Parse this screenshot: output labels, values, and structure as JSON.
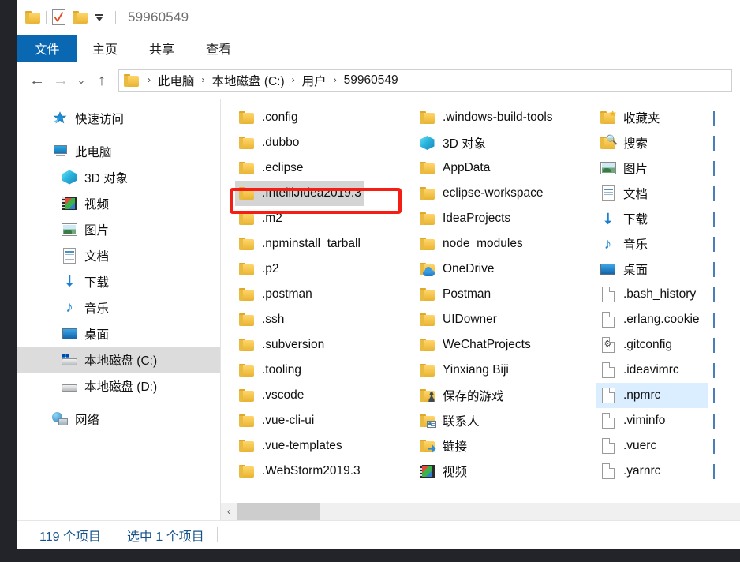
{
  "window": {
    "title": "59960549",
    "quick_access": [
      "folder-icon",
      "checkbox-doc-icon",
      "folder-icon",
      "dropdown-arrow"
    ]
  },
  "ribbon": {
    "tabs": [
      {
        "label": "文件",
        "active": true
      },
      {
        "label": "主页",
        "active": false
      },
      {
        "label": "共享",
        "active": false
      },
      {
        "label": "查看",
        "active": false
      }
    ]
  },
  "addressbar": {
    "back": "←",
    "forward": "→",
    "recent": "⌄",
    "up": "↑",
    "separator": "›",
    "crumbs": [
      "此电脑",
      "本地磁盘 (C:)",
      "用户",
      "59960549"
    ]
  },
  "navpane": {
    "items": [
      {
        "label": "快速访问",
        "icon": "pin-star-icon",
        "level": 1,
        "selected": false,
        "gap_after": true
      },
      {
        "label": "此电脑",
        "icon": "this-pc-icon",
        "level": 1,
        "selected": false
      },
      {
        "label": "3D 对象",
        "icon": "3d-objects-icon",
        "level": 2,
        "selected": false
      },
      {
        "label": "视频",
        "icon": "videos-icon",
        "level": 2,
        "selected": false
      },
      {
        "label": "图片",
        "icon": "pictures-icon",
        "level": 2,
        "selected": false
      },
      {
        "label": "文档",
        "icon": "documents-icon",
        "level": 2,
        "selected": false
      },
      {
        "label": "下载",
        "icon": "downloads-icon",
        "level": 2,
        "selected": false
      },
      {
        "label": "音乐",
        "icon": "music-icon",
        "level": 2,
        "selected": false
      },
      {
        "label": "桌面",
        "icon": "desktop-icon",
        "level": 2,
        "selected": false
      },
      {
        "label": "本地磁盘 (C:)",
        "icon": "windows-drive-icon",
        "level": 2,
        "selected": true
      },
      {
        "label": "本地磁盘 (D:)",
        "icon": "drive-icon",
        "level": 2,
        "selected": false,
        "gap_after": true
      },
      {
        "label": "网络",
        "icon": "network-icon",
        "level": 1,
        "selected": false
      }
    ]
  },
  "filelist": {
    "columns": [
      {
        "items": [
          {
            "name": ".config",
            "icon": "folder-icon",
            "state": "normal"
          },
          {
            "name": ".dubbo",
            "icon": "folder-icon",
            "state": "normal"
          },
          {
            "name": ".eclipse",
            "icon": "folder-icon",
            "state": "normal"
          },
          {
            "name": ".IntelliJIdea2019.3",
            "icon": "folder-icon",
            "state": "selected"
          },
          {
            "name": ".m2",
            "icon": "folder-icon",
            "state": "normal"
          },
          {
            "name": ".npminstall_tarball",
            "icon": "folder-icon",
            "state": "normal"
          },
          {
            "name": ".p2",
            "icon": "folder-icon",
            "state": "normal"
          },
          {
            "name": ".postman",
            "icon": "folder-icon",
            "state": "normal"
          },
          {
            "name": ".ssh",
            "icon": "folder-icon",
            "state": "normal"
          },
          {
            "name": ".subversion",
            "icon": "folder-icon",
            "state": "normal"
          },
          {
            "name": ".tooling",
            "icon": "folder-icon",
            "state": "normal"
          },
          {
            "name": ".vscode",
            "icon": "folder-icon",
            "state": "normal"
          },
          {
            "name": ".vue-cli-ui",
            "icon": "folder-icon",
            "state": "normal"
          },
          {
            "name": ".vue-templates",
            "icon": "folder-icon",
            "state": "normal"
          },
          {
            "name": ".WebStorm2019.3",
            "icon": "folder-icon",
            "state": "normal"
          }
        ]
      },
      {
        "items": [
          {
            "name": ".windows-build-tools",
            "icon": "folder-icon",
            "state": "normal"
          },
          {
            "name": "3D 对象",
            "icon": "3d-objects-icon",
            "state": "normal"
          },
          {
            "name": "AppData",
            "icon": "folder-icon",
            "state": "normal"
          },
          {
            "name": "eclipse-workspace",
            "icon": "folder-icon",
            "state": "normal"
          },
          {
            "name": "IdeaProjects",
            "icon": "folder-icon",
            "state": "normal"
          },
          {
            "name": "node_modules",
            "icon": "folder-icon",
            "state": "normal"
          },
          {
            "name": "OneDrive",
            "icon": "onedrive-icon",
            "state": "normal"
          },
          {
            "name": "Postman",
            "icon": "folder-icon",
            "state": "normal"
          },
          {
            "name": "UIDowner",
            "icon": "folder-icon",
            "state": "normal"
          },
          {
            "name": "WeChatProjects",
            "icon": "folder-icon",
            "state": "normal"
          },
          {
            "name": "Yinxiang Biji",
            "icon": "folder-icon",
            "state": "normal"
          },
          {
            "name": "保存的游戏",
            "icon": "saved-games-icon",
            "state": "normal"
          },
          {
            "name": "联系人",
            "icon": "contacts-icon",
            "state": "normal"
          },
          {
            "name": "链接",
            "icon": "links-icon",
            "state": "normal"
          },
          {
            "name": "视频",
            "icon": "videos-icon",
            "state": "normal"
          }
        ]
      },
      {
        "items": [
          {
            "name": "收藏夹",
            "icon": "favorites-icon",
            "state": "normal"
          },
          {
            "name": "搜索",
            "icon": "searches-icon",
            "state": "normal"
          },
          {
            "name": "图片",
            "icon": "pictures-icon",
            "state": "normal"
          },
          {
            "name": "文档",
            "icon": "documents-icon",
            "state": "normal"
          },
          {
            "name": "下载",
            "icon": "downloads-icon",
            "state": "normal"
          },
          {
            "name": "音乐",
            "icon": "music-icon",
            "state": "normal"
          },
          {
            "name": "桌面",
            "icon": "desktop-icon",
            "state": "normal"
          },
          {
            "name": ".bash_history",
            "icon": "file-icon",
            "state": "normal"
          },
          {
            "name": ".erlang.cookie",
            "icon": "file-icon",
            "state": "normal"
          },
          {
            "name": ".gitconfig",
            "icon": "config-file-icon",
            "state": "normal"
          },
          {
            "name": ".ideavimrc",
            "icon": "file-icon",
            "state": "normal"
          },
          {
            "name": ".npmrc",
            "icon": "file-icon",
            "state": "hover"
          },
          {
            "name": ".viminfo",
            "icon": "file-icon",
            "state": "normal"
          },
          {
            "name": ".vuerc",
            "icon": "file-icon",
            "state": "normal"
          },
          {
            "name": ".yarnrc",
            "icon": "file-icon",
            "state": "normal"
          }
        ]
      }
    ],
    "partial_column_rows": 15
  },
  "scrollbar": {
    "left_arrow": "‹"
  },
  "statusbar": {
    "item_count": "119 个项目",
    "selection": "选中 1 个项目"
  },
  "annotation": {
    "highlight_target": ".IntelliJIdea2019.3",
    "color": "#f51e14"
  },
  "colors": {
    "accent_blue": "#0a67b1",
    "selection_gray": "#d4d4d4",
    "hover_blue": "#dbeeff",
    "status_text": "#16528a",
    "folder_yellow": "#f3c34b",
    "annotation_red": "#f51e14"
  }
}
